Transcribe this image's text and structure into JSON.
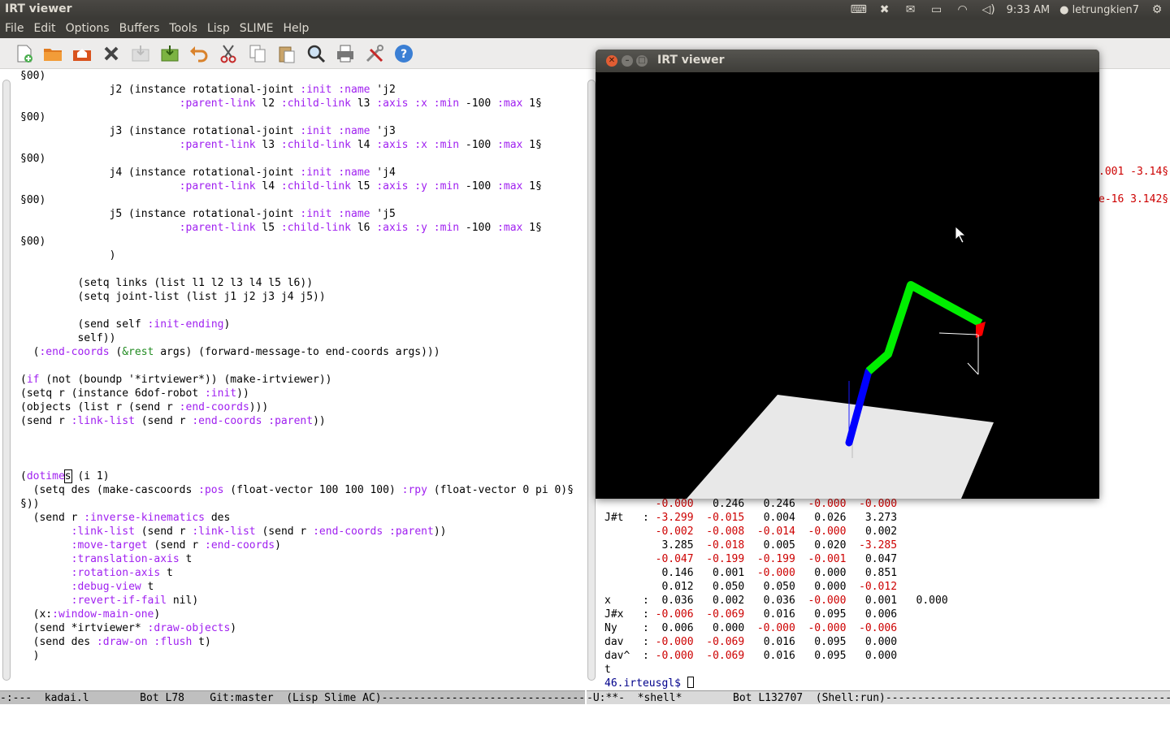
{
  "top_panel": {
    "app_title": "IRT viewer",
    "time": "9:33 AM",
    "user": "letrungkien7"
  },
  "menu": [
    "File",
    "Edit",
    "Options",
    "Buffers",
    "Tools",
    "Lisp",
    "SLIME",
    "Help"
  ],
  "toolbar": {
    "icons": [
      "new-file-icon",
      "open-file-icon",
      "open-directory-icon",
      "close-icon",
      "save-icon",
      "save-as-icon",
      "undo-icon",
      "cut-icon",
      "copy-icon",
      "paste-icon",
      "search-icon",
      "print-icon",
      "preferences-icon",
      "help-icon"
    ]
  },
  "left_editor": {
    "lines": [
      "§00)",
      "              j2 (instance rotational-joint :init :name 'j2",
      "                         :parent-link l2 :child-link l3 :axis :x :min -100 :max 1§",
      "§00)",
      "              j3 (instance rotational-joint :init :name 'j3",
      "                         :parent-link l3 :child-link l4 :axis :x :min -100 :max 1§",
      "§00)",
      "              j4 (instance rotational-joint :init :name 'j4",
      "                         :parent-link l4 :child-link l5 :axis :y :min -100 :max 1§",
      "§00)",
      "              j5 (instance rotational-joint :init :name 'j5",
      "                         :parent-link l5 :child-link l6 :axis :y :min -100 :max 1§",
      "§00)",
      "              )",
      "",
      "         (setq links (list l1 l2 l3 l4 l5 l6))",
      "         (setq joint-list (list j1 j2 j3 j4 j5))",
      "",
      "         (send self :init-ending)",
      "         self))",
      "  (:end-coords (&rest args) (forward-message-to end-coords args)))",
      "",
      "(if (not (boundp '*irtviewer*)) (make-irtviewer))",
      "(setq r (instance 6dof-robot :init))",
      "(objects (list r (send r :end-coords)))",
      "(send r :link-list (send r :end-coords :parent))",
      "",
      "",
      "",
      "(dotimes (i 1)",
      "  (setq des (make-cascoords :pos (float-vector 100 100 100) :rpy (float-vector 0 pi 0)§",
      "§))",
      "  (send r :inverse-kinematics des",
      "        :link-list (send r :link-list (send r :end-coords :parent))",
      "        :move-target (send r :end-coords)",
      "        :translation-axis t",
      "        :rotation-axis t",
      "        :debug-view t",
      "        :revert-if-fail nil)",
      "  (x::window-main-one)",
      "  (send *irtviewer* :draw-objects)",
      "  (send des :draw-on :flush t)",
      "  )"
    ]
  },
  "right_editor": {
    "hidden_fragments": [
      ".001 -3.14§",
      "e-16 3.142§"
    ],
    "lines": [
      "        -0.000   0.246   0.246  -0.000  -0.000",
      "J#t   : -3.299  -0.015   0.004   0.026   3.273",
      "        -0.002  -0.008  -0.014  -0.000   0.002",
      "         3.285  -0.018   0.005   0.020  -3.285",
      "        -0.047  -0.199  -0.199  -0.001   0.047",
      "         0.146   0.001  -0.000   0.000   0.851",
      "         0.012   0.050   0.050   0.000  -0.012",
      "x     :  0.036   0.002   0.036  -0.000   0.001   0.000",
      "J#x   : -0.006  -0.069   0.016   0.095   0.006",
      "Ny    :  0.006   0.000  -0.000  -0.000  -0.006",
      "dav   : -0.000  -0.069   0.016   0.095   0.000",
      "dav^  : -0.000  -0.069   0.016   0.095   0.000",
      "t"
    ],
    "prompt": "46.irteusgl$ "
  },
  "modeline_left": "-:---  kadai.l        Bot L78    Git:master  (Lisp Slime AC)-----------------------------------------------------------",
  "modeline_right": "-U:**-  *shell*        Bot L132707  (Shell:run)--------------------------------------------------------------------------",
  "irt_window": {
    "title": "IRT viewer",
    "colors": {
      "background": "#000000",
      "floor": "#e8e8e8",
      "link_base": "#0000ff",
      "link_arm": "#00ee00",
      "end_effector": "#ff0000",
      "coords_lines": "#ffffff"
    }
  }
}
